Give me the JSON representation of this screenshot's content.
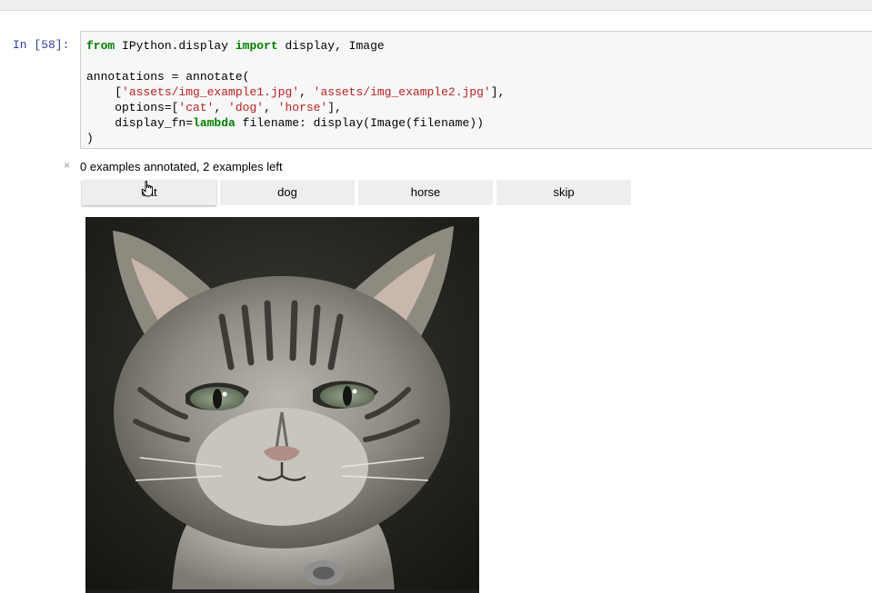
{
  "cell": {
    "prompt": "In [58]:",
    "code": {
      "line1": {
        "kw_from": "from",
        "module": " IPython.display ",
        "kw_import": "import",
        "names": " display, Image"
      },
      "line3": "annotations = annotate(",
      "line4": {
        "indent": "    [",
        "s1": "'assets/img_example1.jpg'",
        "sep": ", ",
        "s2": "'assets/img_example2.jpg'",
        "end": "],"
      },
      "line5": {
        "pre": "    options=[",
        "s1": "'cat'",
        "sep1": ", ",
        "s2": "'dog'",
        "sep2": ", ",
        "s3": "'horse'",
        "end": "],"
      },
      "line6": {
        "pre": "    display_fn=",
        "kw": "lambda",
        "rest": " filename: display(Image(filename))"
      },
      "line7": ")"
    }
  },
  "output": {
    "close_symbol": "×",
    "status": "0 examples annotated, 2 examples left",
    "buttons": [
      "cat",
      "dog",
      "horse",
      "skip"
    ]
  },
  "icons": {
    "close": "close-icon",
    "cursor": "hand-cursor-icon"
  },
  "colors": {
    "prompt": "#303F9F",
    "keyword": "#008000",
    "string": "#BA2121",
    "button_bg": "#eeeeee"
  }
}
